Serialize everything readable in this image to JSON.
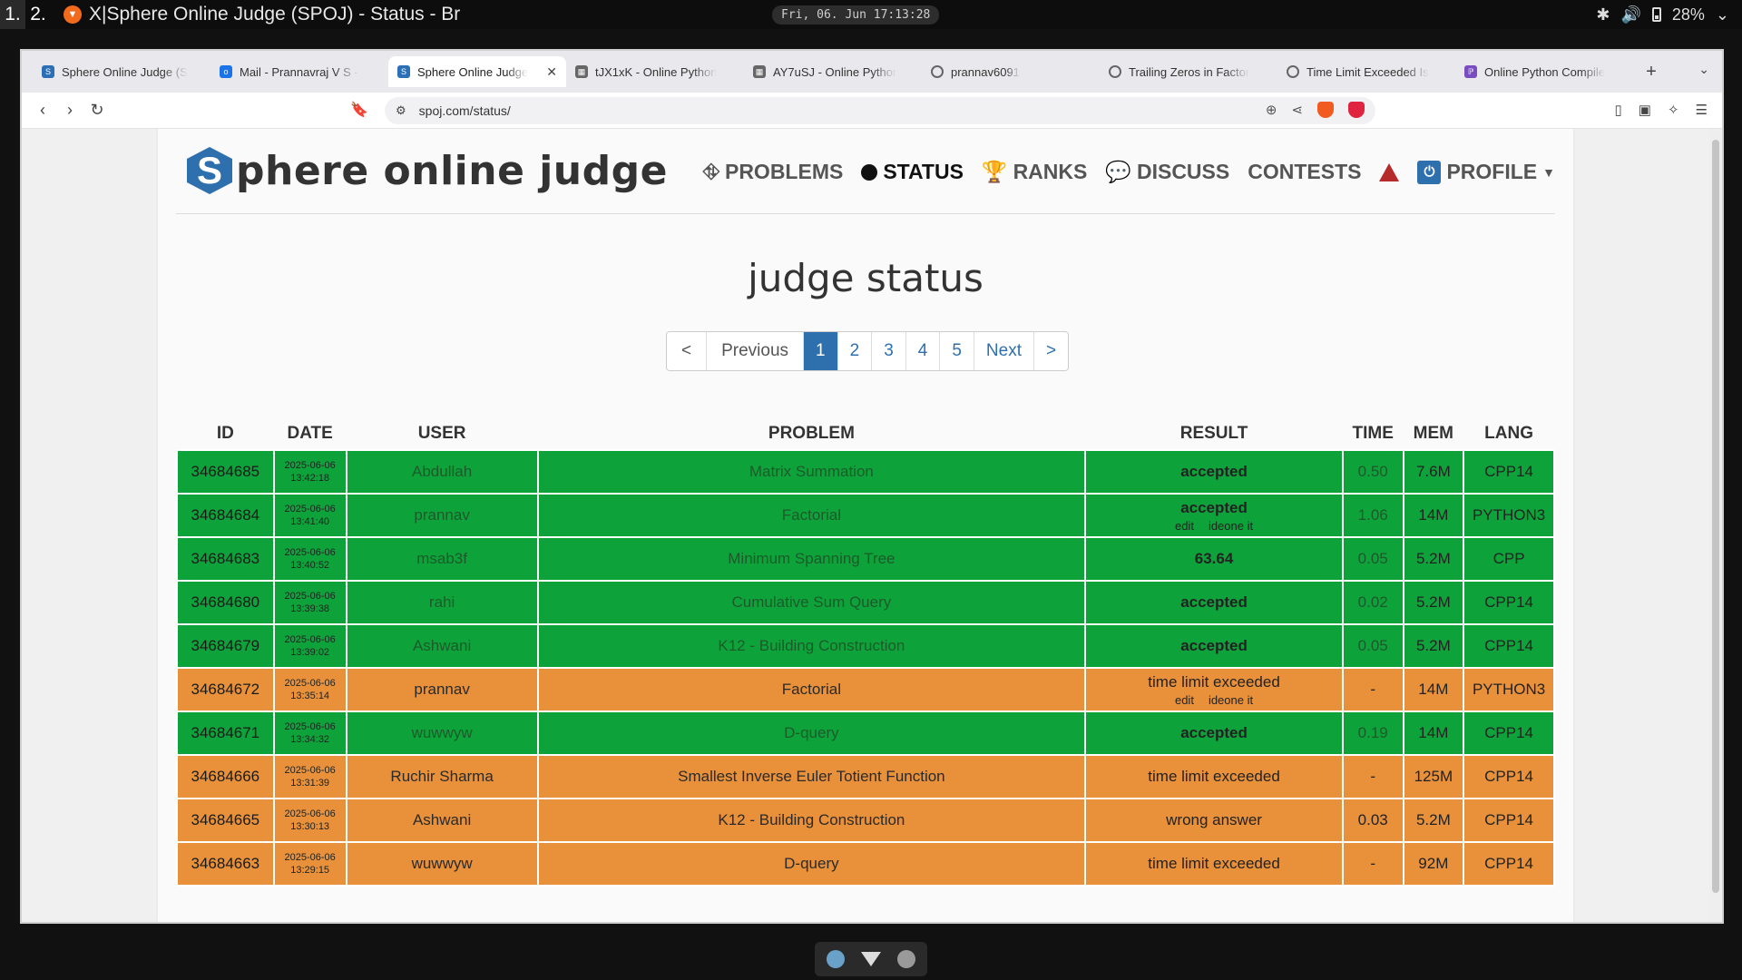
{
  "os": {
    "workspaces": [
      "1.",
      "2."
    ],
    "window_title": "X|Sphere Online Judge (SPOJ) - Status - Br",
    "clock": "Fri, 06. Jun  17:13:28",
    "battery": "28%"
  },
  "browser": {
    "tabs": [
      {
        "label": "Sphere Online Judge (S",
        "icon": "spoj-icon",
        "active": false
      },
      {
        "label": "Mail - Prannavraj V S -",
        "icon": "outlook-icon",
        "active": false
      },
      {
        "label": "Sphere Online Judge",
        "icon": "spoj-icon",
        "active": true
      },
      {
        "label": "tJX1xK - Online Python",
        "icon": "ideone-icon",
        "active": false
      },
      {
        "label": "AY7uSJ - Online Pythor",
        "icon": "ideone-icon",
        "active": false
      },
      {
        "label": "prannav6091",
        "icon": "loading-icon",
        "active": false
      },
      {
        "label": "Trailing Zeros in Factor",
        "icon": "site-icon",
        "active": false
      },
      {
        "label": "Time Limit Exceeded Is",
        "icon": "site-icon",
        "active": false
      },
      {
        "label": "Online Python Compile",
        "icon": "compiler-icon",
        "active": false
      }
    ],
    "url": "spoj.com/status/"
  },
  "site": {
    "logo_letter": "S",
    "logo_text": "phere online judge",
    "nav": [
      {
        "label": "PROBLEMS",
        "icon": "sitemap-icon"
      },
      {
        "label": "STATUS",
        "icon": "circle-icon",
        "active": true
      },
      {
        "label": "RANKS",
        "icon": "trophy-icon"
      },
      {
        "label": "DISCUSS",
        "icon": "comments-icon"
      },
      {
        "label": "CONTESTS",
        "icon": ""
      },
      {
        "label": "PROFILE",
        "icon": "power-icon"
      }
    ],
    "page_title": "judge status",
    "pagination": [
      "<",
      "Previous",
      "1",
      "2",
      "3",
      "4",
      "5",
      "Next",
      ">"
    ],
    "current_page": "1",
    "columns": [
      "ID",
      "DATE",
      "USER",
      "PROBLEM",
      "RESULT",
      "TIME",
      "MEM",
      "LANG"
    ],
    "rows": [
      {
        "id": "34684685",
        "date": "2025-06-06",
        "time_of_day": "13:42:18",
        "user": "Abdullah",
        "problem": "Matrix Summation",
        "result": "accepted",
        "links": false,
        "time": "0.50",
        "mem": "7.6M",
        "lang": "CPP14",
        "status": "ac"
      },
      {
        "id": "34684684",
        "date": "2025-06-06",
        "time_of_day": "13:41:40",
        "user": "prannav",
        "problem": "Factorial",
        "result": "accepted",
        "links": true,
        "time": "1.06",
        "mem": "14M",
        "lang": "PYTHON3",
        "status": "ac"
      },
      {
        "id": "34684683",
        "date": "2025-06-06",
        "time_of_day": "13:40:52",
        "user": "msab3f",
        "problem": "Minimum Spanning Tree",
        "result": "63.64",
        "links": false,
        "time": "0.05",
        "mem": "5.2M",
        "lang": "CPP",
        "status": "ac"
      },
      {
        "id": "34684680",
        "date": "2025-06-06",
        "time_of_day": "13:39:38",
        "user": "rahi",
        "problem": "Cumulative Sum Query",
        "result": "accepted",
        "links": false,
        "time": "0.02",
        "mem": "5.2M",
        "lang": "CPP14",
        "status": "ac"
      },
      {
        "id": "34684679",
        "date": "2025-06-06",
        "time_of_day": "13:39:02",
        "user": "Ashwani",
        "problem": "K12 - Building Construction",
        "result": "accepted",
        "links": false,
        "time": "0.05",
        "mem": "5.2M",
        "lang": "CPP14",
        "status": "ac"
      },
      {
        "id": "34684672",
        "date": "2025-06-06",
        "time_of_day": "13:35:14",
        "user": "prannav",
        "problem": "Factorial",
        "result": "time limit exceeded",
        "links": true,
        "time": "-",
        "mem": "14M",
        "lang": "PYTHON3",
        "status": "tle"
      },
      {
        "id": "34684671",
        "date": "2025-06-06",
        "time_of_day": "13:34:32",
        "user": "wuwwyw",
        "problem": "D-query",
        "result": "accepted",
        "links": false,
        "time": "0.19",
        "mem": "14M",
        "lang": "CPP14",
        "status": "ac"
      },
      {
        "id": "34684666",
        "date": "2025-06-06",
        "time_of_day": "13:31:39",
        "user": "Ruchir Sharma",
        "problem": "Smallest Inverse Euler Totient Function",
        "result": "time limit exceeded",
        "links": false,
        "time": "-",
        "mem": "125M",
        "lang": "CPP14",
        "status": "tle"
      },
      {
        "id": "34684665",
        "date": "2025-06-06",
        "time_of_day": "13:30:13",
        "user": "Ashwani",
        "problem": "K12 - Building Construction",
        "result": "wrong answer",
        "links": false,
        "time": "0.03",
        "mem": "5.2M",
        "lang": "CPP14",
        "status": "tle"
      },
      {
        "id": "34684663",
        "date": "2025-06-06",
        "time_of_day": "13:29:15",
        "user": "wuwwyw",
        "problem": "D-query",
        "result": "time limit exceeded",
        "links": false,
        "time": "-",
        "mem": "92M",
        "lang": "CPP14",
        "status": "tle"
      }
    ],
    "link_edit": "edit",
    "link_ideone": "ideone it"
  },
  "colors": {
    "accepted": "#0ea33a",
    "failed": "#e8913a",
    "brand": "#2e6fad"
  }
}
